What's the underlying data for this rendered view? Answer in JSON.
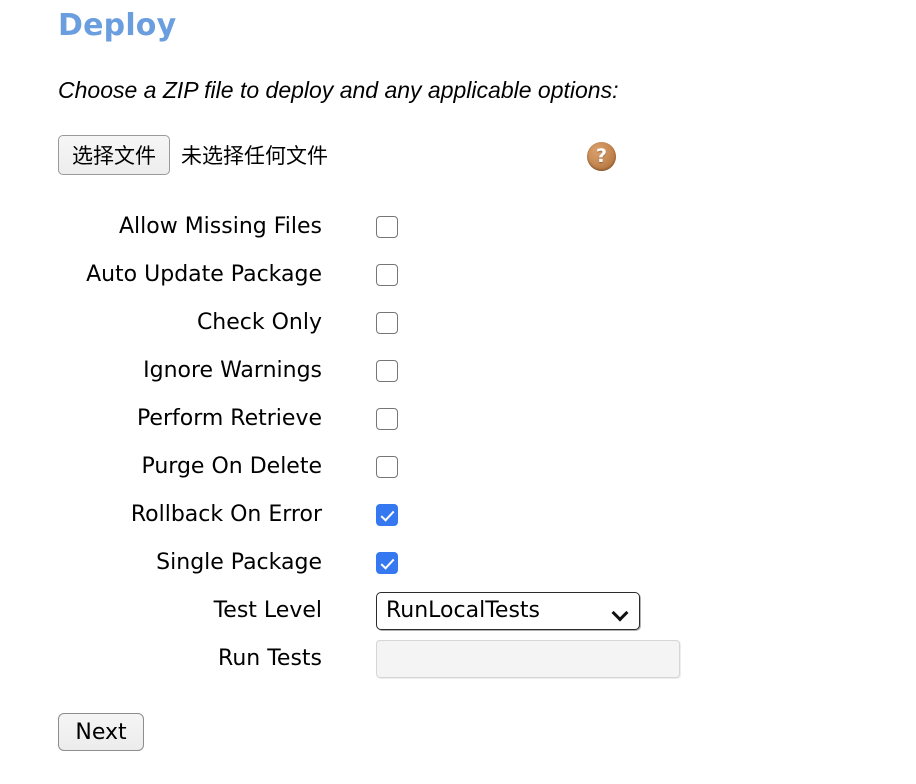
{
  "page": {
    "heading": "Deploy",
    "subtitle": "Choose a ZIP file to deploy and any applicable options:",
    "heading_color": "#6a9ede",
    "accent_checked_color": "#3578f0"
  },
  "file_picker": {
    "button_label": "选择文件",
    "file_status": "未选择任何文件",
    "help_icon": "question-mark-icon",
    "help_icon_color": "#c98b55",
    "help_glyph": "?"
  },
  "options": [
    {
      "label": "Allow Missing Files",
      "checked": false
    },
    {
      "label": "Auto Update Package",
      "checked": false
    },
    {
      "label": "Check Only",
      "checked": false
    },
    {
      "label": "Ignore Warnings",
      "checked": false
    },
    {
      "label": "Perform Retrieve",
      "checked": false
    },
    {
      "label": "Purge On Delete",
      "checked": false
    },
    {
      "label": "Rollback On Error",
      "checked": true
    },
    {
      "label": "Single Package",
      "checked": true
    }
  ],
  "test_level": {
    "label": "Test Level",
    "selected": "RunLocalTests",
    "chevron_icon": "chevron-down-icon"
  },
  "run_tests": {
    "label": "Run Tests",
    "value": "",
    "placeholder": "",
    "disabled": true
  },
  "footer": {
    "next_label": "Next"
  }
}
